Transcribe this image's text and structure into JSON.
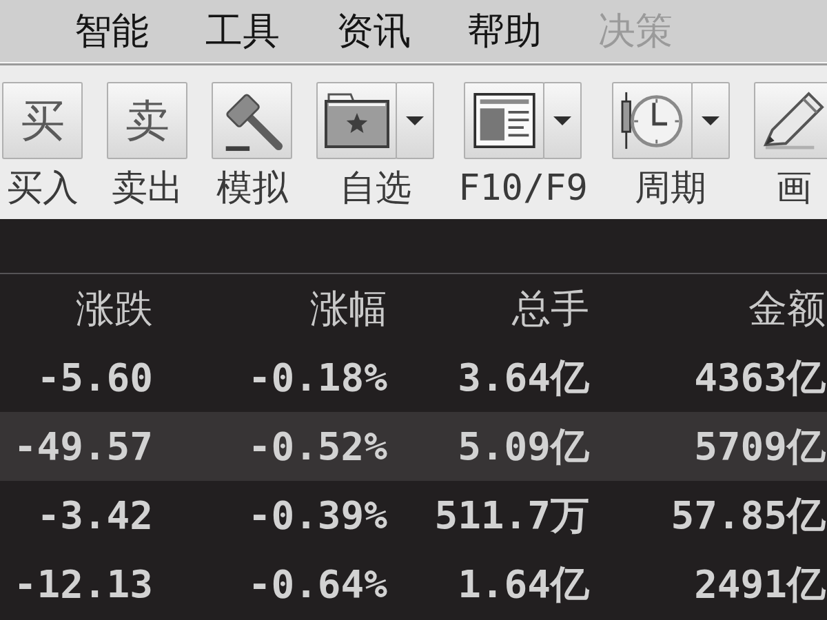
{
  "menu_bar": {
    "items": [
      {
        "label": "智能",
        "disabled": false
      },
      {
        "label": "工具",
        "disabled": false
      },
      {
        "label": "资讯",
        "disabled": false
      },
      {
        "label": "帮助",
        "disabled": false
      },
      {
        "label": "决策",
        "disabled": true
      }
    ]
  },
  "toolbar": {
    "buttons": [
      {
        "label": "买入",
        "glyph": "买",
        "dropdown": false
      },
      {
        "label": "卖出",
        "glyph": "卖",
        "dropdown": false
      },
      {
        "label": "模拟",
        "dropdown": false
      },
      {
        "label": "自选",
        "dropdown": true
      },
      {
        "label": "F10/F9",
        "dropdown": true
      },
      {
        "label": "周期",
        "dropdown": true
      },
      {
        "label": "画",
        "dropdown": false
      }
    ]
  },
  "table": {
    "columns": [
      "涨跌",
      "涨幅",
      "总手",
      "金额"
    ],
    "rows": [
      {
        "cells": [
          "-5.60",
          "-0.18%",
          "3.64亿",
          "4363亿"
        ],
        "selected": false
      },
      {
        "cells": [
          "-49.57",
          "-0.52%",
          "5.09亿",
          "5709亿"
        ],
        "selected": true
      },
      {
        "cells": [
          "-3.42",
          "-0.39%",
          "511.7万",
          "57.85亿"
        ],
        "selected": false
      },
      {
        "cells": [
          "-12.13",
          "-0.64%",
          "1.64亿",
          "2491亿"
        ],
        "selected": false
      }
    ]
  }
}
